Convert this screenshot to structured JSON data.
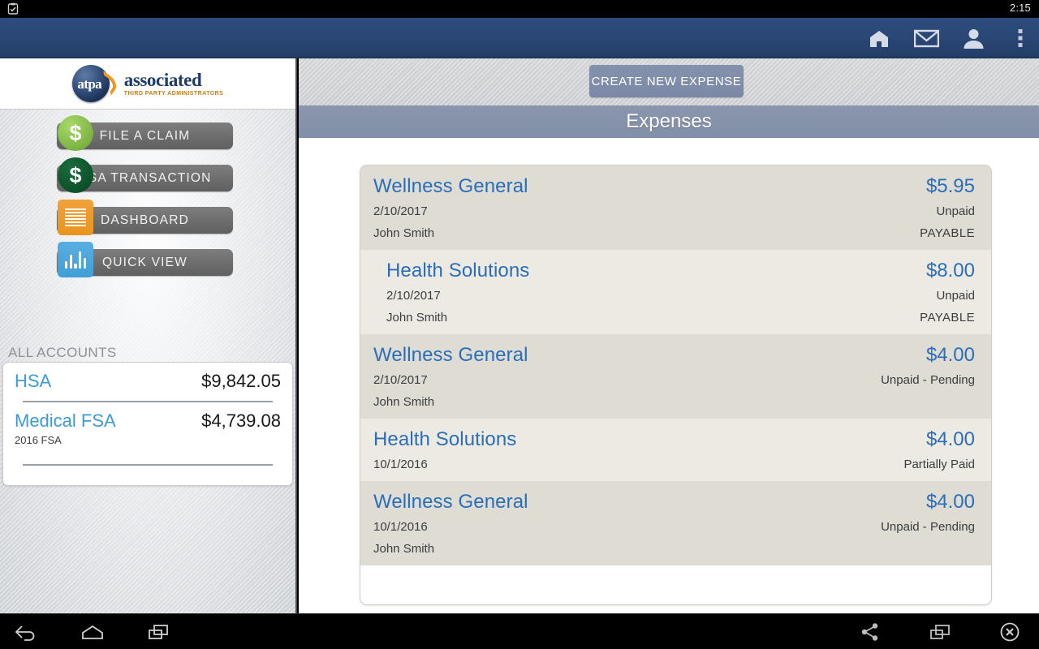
{
  "status_bar": {
    "left_icon": "screenshot-clipboard-icon",
    "clock": "2:15"
  },
  "app_bar": {
    "icons": [
      {
        "name": "home-icon",
        "label": "Home"
      },
      {
        "name": "mail-envelope-icon",
        "label": "Messages"
      },
      {
        "name": "user-profile-icon",
        "label": "Profile"
      },
      {
        "name": "overflow-menu-icon",
        "label": "More options"
      }
    ],
    "background_color": "#294674"
  },
  "sidebar": {
    "logo": {
      "badge_text": "atpa",
      "word_main": "associated",
      "word_sub": "THIRD PARTY ADMINISTRATORS"
    },
    "nav_items": [
      {
        "label": "FILE A CLAIM",
        "icon": "dollar-circle-green-icon",
        "glyph": "$"
      },
      {
        "label": "HSA TRANSACTION",
        "icon": "dollar-circle-darkgreen-icon",
        "glyph": "$"
      },
      {
        "label": "DASHBOARD",
        "icon": "receipt-lines-orange-icon",
        "glyph": ""
      },
      {
        "label": "QUICK VIEW",
        "icon": "bar-chart-blue-icon",
        "glyph": ""
      }
    ],
    "all_accounts_label": "ALL ACCOUNTS",
    "accounts": [
      {
        "name": "HSA",
        "amount": "$9,842.05",
        "sub": ""
      },
      {
        "name": "Medical FSA",
        "amount": "$4,739.08",
        "sub": "2016 FSA"
      }
    ]
  },
  "main": {
    "create_button_label": "CREATE NEW EXPENSE",
    "page_title": "Expenses",
    "expenses": [
      {
        "merchant": "Wellness General",
        "amount": "$5.95",
        "date": "2/10/2017",
        "status": "Unpaid",
        "person": "John Smith",
        "payable": "PAYABLE"
      },
      {
        "merchant": "Health Solutions",
        "amount": "$8.00",
        "date": "2/10/2017",
        "status": "Unpaid",
        "person": "John Smith",
        "payable": "PAYABLE"
      },
      {
        "merchant": "Wellness General",
        "amount": "$4.00",
        "date": "2/10/2017",
        "status": "Unpaid - Pending",
        "person": "John Smith",
        "payable": ""
      },
      {
        "merchant": "Health Solutions",
        "amount": "$4.00",
        "date": "10/1/2016",
        "status": "Partially Paid",
        "person": "",
        "payable": ""
      },
      {
        "merchant": "Wellness General",
        "amount": "$4.00",
        "date": "10/1/2016",
        "status": "Unpaid - Pending",
        "person": "John Smith",
        "payable": ""
      }
    ]
  },
  "nav_bar": {
    "buttons": [
      {
        "name": "back-icon",
        "label": "Back"
      },
      {
        "name": "home-icon",
        "label": "Home"
      },
      {
        "name": "recents-icon",
        "label": "Recent apps"
      },
      {
        "name": "share-icon",
        "label": "Share"
      },
      {
        "name": "screenshot-icon",
        "label": "Screenshot"
      },
      {
        "name": "close-icon",
        "label": "Close"
      }
    ]
  },
  "colors": {
    "app_bar": "#294674",
    "accent_blue": "#2a6ebb",
    "link_blue": "#3d9ad4",
    "title_bar": "#8a96ad",
    "row_dark": "#dedcd3",
    "row_light": "#eceae2"
  }
}
